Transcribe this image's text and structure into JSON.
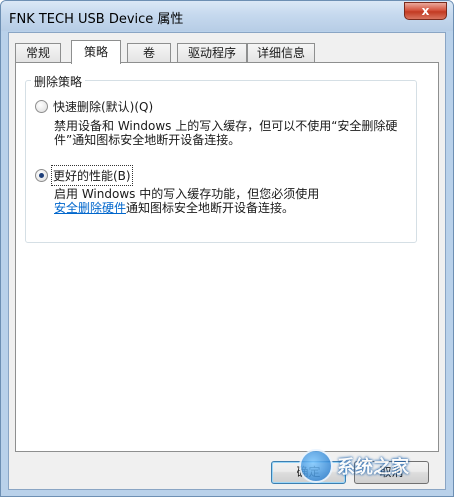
{
  "window": {
    "title": "FNK TECH USB Device 属性",
    "close_label": "x"
  },
  "tabs": [
    {
      "label": "常规",
      "active": false
    },
    {
      "label": "策略",
      "active": true
    },
    {
      "label": "卷",
      "active": false
    },
    {
      "label": "驱动程序",
      "active": false
    },
    {
      "label": "详细信息",
      "active": false
    }
  ],
  "policy_group": {
    "label": "删除策略",
    "options": [
      {
        "label": "快速删除(默认)(Q)",
        "checked": false,
        "description": "禁用设备和 Windows 上的写入缓存，但可以不使用“安全删除硬件”通知图标安全地断开设备连接。"
      },
      {
        "label": "更好的性能(B)",
        "checked": true,
        "description_prefix": "启用 Windows 中的写入缓存功能，但您必须使用",
        "description_link": "安全删除硬件",
        "description_suffix": "通知图标安全地断开设备连接。"
      }
    ]
  },
  "buttons": {
    "ok_label": "确定",
    "cancel_label": "取消"
  },
  "watermark": {
    "text": "系统之家"
  }
}
